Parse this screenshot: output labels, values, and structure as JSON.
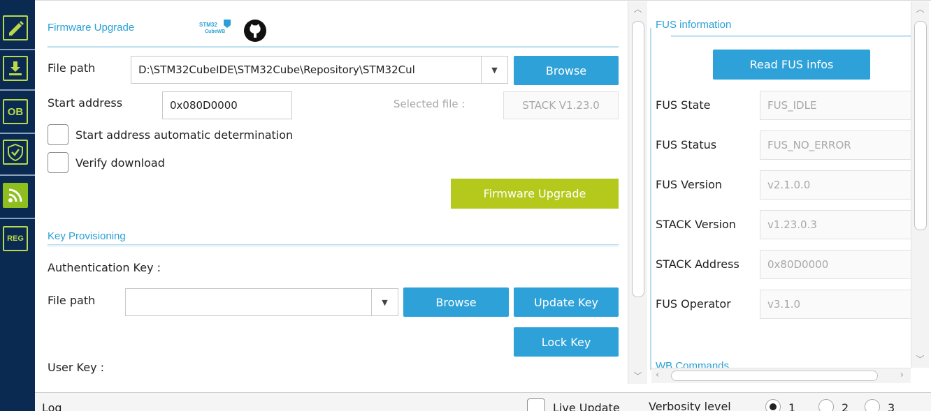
{
  "sidebar": {
    "items": [
      {
        "icon": "edit-icon",
        "label": ""
      },
      {
        "icon": "download-icon",
        "label": ""
      },
      {
        "icon": "option-bytes-icon",
        "label": "OB"
      },
      {
        "icon": "shield-icon",
        "label": ""
      },
      {
        "icon": "wireless-icon",
        "label": ""
      },
      {
        "icon": "registers-icon",
        "label": "REG"
      }
    ]
  },
  "firmware_upgrade": {
    "title": "Firmware Upgrade",
    "logo_text_top": "STM32",
    "logo_text_bottom": "CubeWB",
    "file_path_label": "File path",
    "file_path_value": "D:\\STM32CubeIDE\\STM32Cube\\Repository\\STM32Cul",
    "browse_label": "Browse",
    "start_address_label": "Start address",
    "start_address_value": "0x080D0000",
    "selected_file_label": "Selected file :",
    "selected_file_value": "STACK V1.23.0",
    "auto_determination_label": "Start address automatic determination",
    "verify_download_label": "Verify download",
    "upgrade_button_label": "Firmware Upgrade"
  },
  "key_provisioning": {
    "title": "Key Provisioning",
    "auth_key_label": "Authentication Key :",
    "file_path_label": "File path",
    "file_path_value": "",
    "browse_label": "Browse",
    "update_key_label": "Update Key",
    "lock_key_label": "Lock Key",
    "user_key_label": "User Key :"
  },
  "fus_information": {
    "title": "FUS information",
    "read_button_label": "Read FUS infos",
    "rows": [
      {
        "label": "FUS State",
        "value": "FUS_IDLE"
      },
      {
        "label": "FUS Status",
        "value": "FUS_NO_ERROR"
      },
      {
        "label": "FUS Version",
        "value": "v2.1.0.0"
      },
      {
        "label": "STACK Version",
        "value": "v1.23.0.3"
      },
      {
        "label": "STACK Address",
        "value": "0x80D0000"
      },
      {
        "label": "FUS Operator",
        "value": "v3.1.0"
      }
    ],
    "next_section_title": "WB Commands"
  },
  "log": {
    "title": "Log",
    "live_update_label": "Live Update",
    "verbosity_label": "Verbosity level",
    "verbosity_options": [
      "1",
      "2",
      "3"
    ],
    "verbosity_selected": "1"
  },
  "colors": {
    "accent_blue": "#2ea2d8",
    "accent_green": "#b5c91d",
    "sidebar_bg": "#0b2a52"
  }
}
